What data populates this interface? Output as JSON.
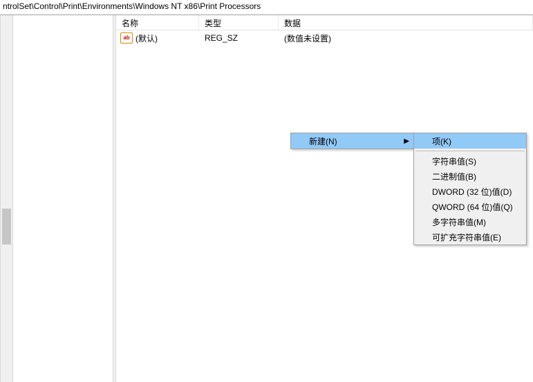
{
  "path_bar": "ntrolSet\\Control\\Print\\Environments\\Windows NT x86\\Print Processors",
  "columns": {
    "name": "名称",
    "type": "类型",
    "data": "数据"
  },
  "rows": [
    {
      "name": "(默认)",
      "type": "REG_SZ",
      "data": "(数值未设置)",
      "icon": "ab"
    }
  ],
  "context_menu": {
    "new_label": "新建(N)",
    "submenu": [
      "项(K)",
      "字符串值(S)",
      "二进制值(B)",
      "DWORD (32 位)值(D)",
      "QWORD (64 位)值(Q)",
      "多字符串值(M)",
      "可扩充字符串值(E)"
    ],
    "highlight_index": 0
  }
}
